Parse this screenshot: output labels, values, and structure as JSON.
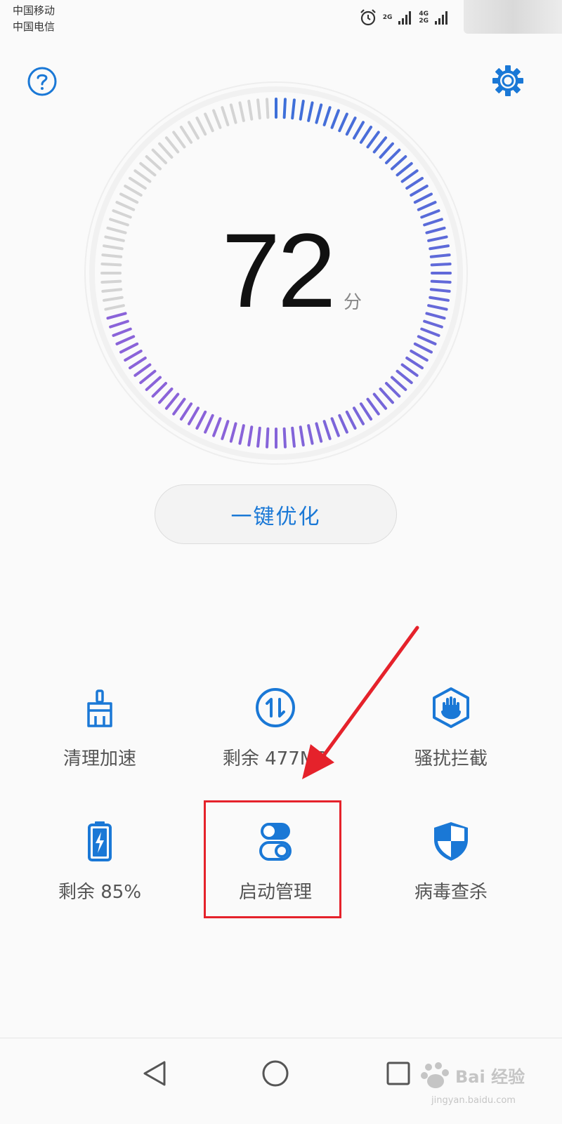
{
  "status_bar": {
    "carrier_1": "中国移动",
    "carrier_2": "中国电信",
    "network_1": "2G",
    "network_2_top": "4G",
    "network_2_bottom": "2G",
    "icons": [
      "alarm-icon",
      "signal-icon",
      "signal-icon"
    ]
  },
  "header": {
    "help_icon": "question-circle-icon",
    "settings_icon": "gear-icon"
  },
  "score": {
    "value": "72",
    "unit": "分",
    "ratio": 0.72
  },
  "optimize_button": {
    "label": "一键优化"
  },
  "tiles": [
    {
      "label": "清理加速",
      "icon": "broom-icon"
    },
    {
      "label": "剩余 477MB",
      "icon": "data-transfer-icon"
    },
    {
      "label": "骚扰拦截",
      "icon": "hand-block-icon"
    },
    {
      "label": "剩余 85%",
      "icon": "battery-icon"
    },
    {
      "label": "启动管理",
      "icon": "toggle-switch-icon"
    },
    {
      "label": "病毒查杀",
      "icon": "shield-icon"
    }
  ],
  "navigation": {
    "back_icon": "back-triangle-icon",
    "home_icon": "home-circle-icon",
    "recent_icon": "recent-square-icon"
  },
  "watermark": {
    "text": "Bai 经验",
    "sub": "jingyan.baidu.com"
  },
  "colors": {
    "accent": "#1a78d6",
    "gauge_blue": "#3d6fd9",
    "gauge_purple": "#8a63d9",
    "gauge_inactive": "#d4d4d4",
    "highlight": "#e5222b"
  }
}
